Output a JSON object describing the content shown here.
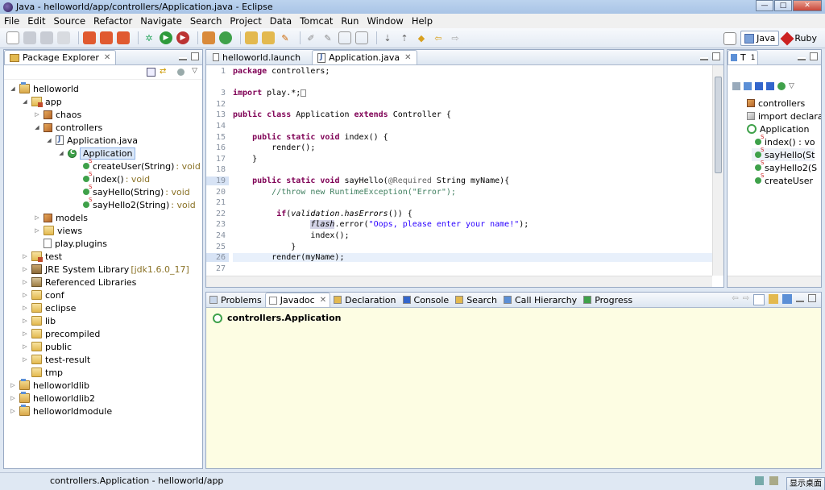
{
  "window": {
    "title": "Java - helloworld/app/controllers/Application.java - Eclipse",
    "buttons": [
      "—",
      "□",
      "✕"
    ]
  },
  "menu": [
    "File",
    "Edit",
    "Source",
    "Refactor",
    "Navigate",
    "Search",
    "Project",
    "Data",
    "Tomcat",
    "Run",
    "Window",
    "Help"
  ],
  "perspectives": [
    {
      "label": "Java",
      "active": true
    },
    {
      "label": "Ruby",
      "active": false
    }
  ],
  "package_explorer": {
    "tab_label": "Package Explorer",
    "tree": [
      {
        "label": "helloworld",
        "icon": "project-icon",
        "depth": 0,
        "expanded": true
      },
      {
        "label": "app",
        "icon": "source-folder-icon",
        "depth": 1,
        "expanded": true
      },
      {
        "label": "chaos",
        "icon": "package-icon",
        "depth": 2,
        "expanded": false
      },
      {
        "label": "controllers",
        "icon": "package-icon",
        "depth": 2,
        "expanded": true
      },
      {
        "label": "Application.java",
        "icon": "java-file-icon",
        "depth": 3,
        "expanded": true
      },
      {
        "label": "Application",
        "icon": "class-icon",
        "depth": 4,
        "expanded": true,
        "selected": true
      },
      {
        "label": "createUser(String)",
        "type": ": void",
        "icon": "static-method-icon",
        "depth": 5
      },
      {
        "label": "index()",
        "type": ": void",
        "icon": "static-method-icon",
        "depth": 5
      },
      {
        "label": "sayHello(String)",
        "type": ": void",
        "icon": "static-method-icon",
        "depth": 5
      },
      {
        "label": "sayHello2(String)",
        "type": ": void",
        "icon": "static-method-icon",
        "depth": 5
      },
      {
        "label": "models",
        "icon": "package-icon",
        "depth": 2,
        "expanded": false
      },
      {
        "label": "views",
        "icon": "folder-icon",
        "depth": 2,
        "expanded": false
      },
      {
        "label": "play.plugins",
        "icon": "file-icon",
        "depth": 2
      },
      {
        "label": "test",
        "icon": "source-folder-icon",
        "depth": 1,
        "expanded": false
      },
      {
        "label": "JRE System Library",
        "type": "[jdk1.6.0_17]",
        "icon": "library-icon",
        "depth": 1,
        "expanded": false
      },
      {
        "label": "Referenced Libraries",
        "icon": "referenced-libraries-icon",
        "depth": 1,
        "expanded": false
      },
      {
        "label": "conf",
        "icon": "folder-icon",
        "depth": 1,
        "expanded": false
      },
      {
        "label": "eclipse",
        "icon": "folder-icon",
        "depth": 1,
        "expanded": false
      },
      {
        "label": "lib",
        "icon": "folder-icon",
        "depth": 1,
        "expanded": false
      },
      {
        "label": "precompiled",
        "icon": "folder-icon",
        "depth": 1,
        "expanded": false
      },
      {
        "label": "public",
        "icon": "folder-icon",
        "depth": 1,
        "expanded": false
      },
      {
        "label": "test-result",
        "icon": "folder-icon",
        "depth": 1,
        "expanded": false
      },
      {
        "label": "tmp",
        "icon": "folder-icon",
        "depth": 1
      },
      {
        "label": "helloworldlib",
        "icon": "project-icon",
        "depth": 0,
        "expanded": false
      },
      {
        "label": "helloworldlib2",
        "icon": "project-icon",
        "depth": 0,
        "expanded": false
      },
      {
        "label": "helloworldmodule",
        "icon": "project-icon",
        "depth": 0,
        "expanded": false
      }
    ]
  },
  "editor": {
    "tabs": [
      {
        "label": "helloworld.launch",
        "active": false
      },
      {
        "label": "Application.java",
        "active": true
      }
    ],
    "lines": [
      {
        "n": "1",
        "html": "<span class=\"kw\">package</span> controllers;"
      },
      {
        "n": "",
        "html": ""
      },
      {
        "n": "3",
        "html": "<span class=\"kw\">import</span> play.*;<span style=\"border:1px solid #888;display:inline-block;width:7px;height:9px;vertical-align:middle\"></span>"
      },
      {
        "n": "12",
        "html": ""
      },
      {
        "n": "13",
        "html": "<span class=\"kw\">public class</span> Application <span class=\"kw\">extends</span> Controller {"
      },
      {
        "n": "14",
        "html": ""
      },
      {
        "n": "15",
        "html": "    <span class=\"kw\">public static void</span> index() {"
      },
      {
        "n": "16",
        "html": "        render();"
      },
      {
        "n": "17",
        "html": "    }"
      },
      {
        "n": "18",
        "html": ""
      },
      {
        "n": "19",
        "html": "    <span class=\"kw\">public static void</span> sayHello(<span class=\"ann\">@Required</span> String myName){"
      },
      {
        "n": "20",
        "html": "        <span class=\"cm\">//throw new RuntimeException(\"Error\");</span>"
      },
      {
        "n": "21",
        "html": ""
      },
      {
        "n": "22",
        "html": "         <span class=\"kw\">if</span>(<span class=\"it\">validation</span>.<span class=\"it\">hasErrors</span>()) {"
      },
      {
        "n": "23",
        "html": "                <span class=\"it\" style=\"background:#d4d4e8\">flash</span>.error(<span class=\"str\">\"Oops, please enter your name!\"</span>);"
      },
      {
        "n": "24",
        "html": "                index();"
      },
      {
        "n": "25",
        "html": "            }"
      },
      {
        "n": "26",
        "html": "        render(myName);"
      },
      {
        "n": "27",
        "html": ""
      }
    ]
  },
  "outline": {
    "tab_label": "T",
    "tab_label2": "1",
    "items": [
      {
        "label": "controllers",
        "icon": "package-icon",
        "indent": 0
      },
      {
        "label": "import declarat",
        "icon": "import-icon",
        "indent": 0
      },
      {
        "label": "Application",
        "icon": "class-icon",
        "indent": 0
      },
      {
        "label": "index() : vo",
        "icon": "static-method-icon",
        "indent": 1
      },
      {
        "label": "sayHello(St",
        "icon": "static-method-icon",
        "indent": 1
      },
      {
        "label": "sayHello2(S",
        "icon": "static-method-icon",
        "indent": 1
      },
      {
        "label": "createUser",
        "icon": "static-method-icon",
        "indent": 1
      }
    ]
  },
  "bottom_panel": {
    "tabs": [
      {
        "label": "Problems",
        "active": false
      },
      {
        "label": "Javadoc",
        "active": true
      },
      {
        "label": "Declaration",
        "active": false
      },
      {
        "label": "Console",
        "active": false
      },
      {
        "label": "Search",
        "active": false
      },
      {
        "label": "Call Hierarchy",
        "active": false
      },
      {
        "label": "Progress",
        "active": false
      }
    ],
    "javadoc_title": "controllers.Application"
  },
  "status": {
    "text": "controllers.Application - helloworld/app",
    "desktop_button": "显示桌面"
  }
}
